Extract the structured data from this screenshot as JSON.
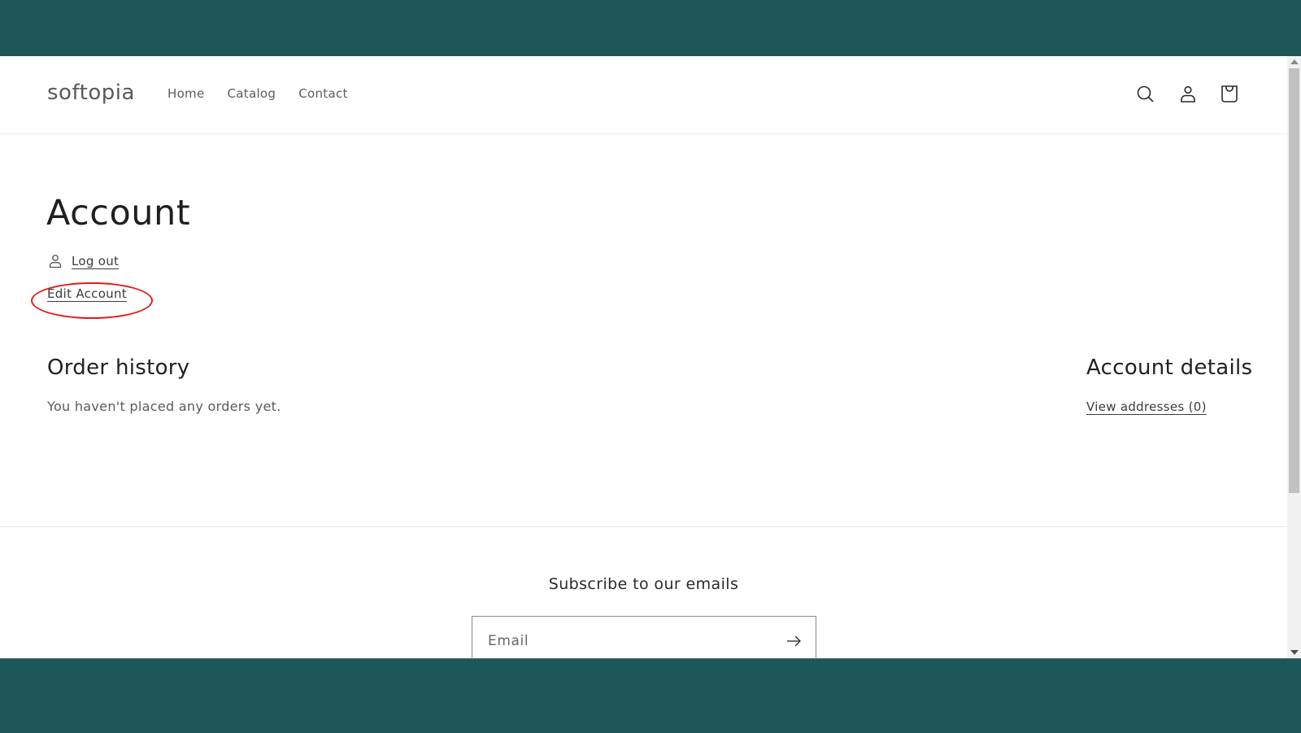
{
  "store": {
    "name": "softopia"
  },
  "nav": {
    "items": [
      {
        "label": "Home"
      },
      {
        "label": "Catalog"
      },
      {
        "label": "Contact"
      }
    ]
  },
  "header_icons": {
    "search": "search-icon",
    "account": "account-icon",
    "cart": "cart-icon"
  },
  "account": {
    "title": "Account",
    "logout_label": "Log out",
    "edit_label": "Edit Account"
  },
  "order_history": {
    "heading": "Order history",
    "empty_text": "You haven't placed any orders yet."
  },
  "account_details": {
    "heading": "Account details",
    "addresses_link": "View addresses (0)"
  },
  "newsletter": {
    "heading": "Subscribe to our emails",
    "email_placeholder": "Email",
    "email_value": ""
  },
  "annotation": {
    "color": "#e21b1b",
    "target": "Edit Account"
  },
  "colors": {
    "brand_band": "#1e5757"
  }
}
